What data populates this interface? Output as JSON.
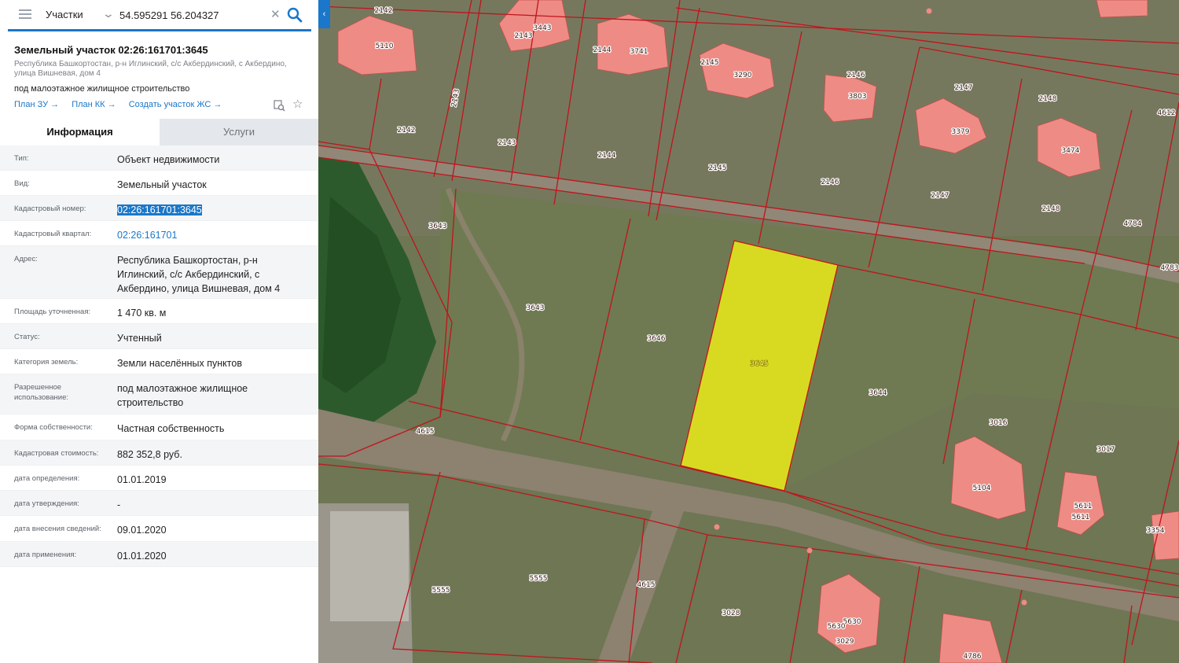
{
  "search": {
    "layer": "Участки",
    "query": "54.595291 56.204327"
  },
  "object": {
    "title": "Земельный участок 02:26:161701:3645",
    "address_short": "Республика Башкортостан, р-н Иглинский, с/с Акбердинский, с Акбердино, улица Вишневая, дом 4",
    "use": "под малоэтажное жилищное строительство",
    "links": [
      "План ЗУ →",
      "План КК →",
      "Создать участок ЖС →"
    ]
  },
  "tabs": [
    "Информация",
    "Услуги"
  ],
  "properties": [
    {
      "key": "Тип:",
      "value": "Объект недвижимости"
    },
    {
      "key": "Вид:",
      "value": "Земельный участок"
    },
    {
      "key": "Кадастровый номер:",
      "value": "02:26:161701:3645"
    },
    {
      "key": "Кадастровый квартал:",
      "value": "02:26:161701"
    },
    {
      "key": "Адрес:",
      "value": "Республика Башкортостан, р-н Иглинский, с/с Акбердинский, с Акбердино, улица Вишневая, дом 4"
    },
    {
      "key": "Площадь уточненная:",
      "value": "1 470 кв. м"
    },
    {
      "key": "Статус:",
      "value": "Учтенный"
    },
    {
      "key": "Категория земель:",
      "value": "Земли населённых пунктов"
    },
    {
      "key": "Разрешенное использование:",
      "value": "под малоэтажное жилищное строительство"
    },
    {
      "key": "Форма собственности:",
      "value": "Частная собственность"
    },
    {
      "key": "Кадастровая стоимость:",
      "value": "882 352,8 руб."
    },
    {
      "key": "дата определения:",
      "value": "01.01.2019"
    },
    {
      "key": "дата утверждения:",
      "value": "-"
    },
    {
      "key": "дата внесения сведений:",
      "value": "09.01.2020"
    },
    {
      "key": "дата применения:",
      "value": "01.01.2020"
    }
  ],
  "map": {
    "selected_parcel": "3645",
    "parcel_labels": [
      "2142",
      "2143",
      "2144",
      "2145",
      "2146",
      "2147",
      "2148",
      "4612",
      "5110",
      "3443",
      "3741",
      "3290",
      "3803",
      "3379",
      "3474",
      "2143",
      "2142",
      "2143",
      "2144",
      "2145",
      "2146",
      "2147",
      "2148",
      "4784",
      "3643",
      "3643",
      "3646",
      "3645",
      "3644",
      "4783",
      "4615",
      "3016",
      "3017",
      "5104",
      "5611",
      "5611",
      "3354",
      "5555",
      "5555",
      "4615",
      "3028",
      "5630",
      "5630",
      "3029",
      "4786"
    ],
    "colors": {
      "selected_fill": "#e1e21e",
      "building_fill": "#ee8b84",
      "boundary": "#c0141c"
    }
  }
}
